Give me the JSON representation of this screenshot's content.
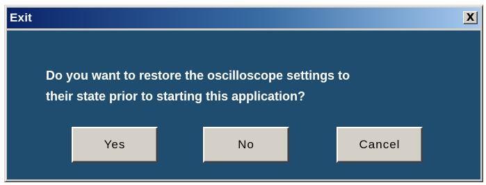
{
  "window": {
    "title": "Exit",
    "close_glyph": "X",
    "colors": {
      "titlebar_start": "#0a246a",
      "titlebar_end": "#a6caf0",
      "client_background": "#1f4d6f",
      "message_text": "#ffffff"
    }
  },
  "dialog": {
    "message_line1": "Do you want to restore the oscilloscope settings to",
    "message_line2": "their state prior to starting this application?"
  },
  "buttons": {
    "yes_label": "Yes",
    "no_label": "No",
    "cancel_label": "Cancel"
  }
}
